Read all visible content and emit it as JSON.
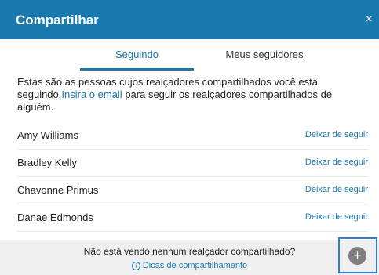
{
  "header": {
    "title": "Compartilhar",
    "close_glyph": "×"
  },
  "tabs": [
    {
      "label": "Seguindo",
      "active": true
    },
    {
      "label": "Meus seguidores",
      "active": false
    }
  ],
  "intro": {
    "text_before": "Estas são as pessoas cujos realçadores compartilhados você está seguindo.",
    "link": "Insira o email",
    "text_after": " para seguir os realçadores compartilhados de alguém."
  },
  "people": [
    {
      "name": "Amy Williams",
      "action": "Deixar de seguir"
    },
    {
      "name": "Bradley Kelly",
      "action": "Deixar de seguir"
    },
    {
      "name": "Chavonne Primus",
      "action": "Deixar de seguir"
    },
    {
      "name": "Danae Edmonds",
      "action": "Deixar de seguir"
    }
  ],
  "footer": {
    "question": "Não está vendo nenhum realçador compartilhado?",
    "tips_icon": "ⓘ",
    "tips_link": "Dicas de compartilhamento"
  },
  "fab": {
    "glyph": "+",
    "icon": "add-icon"
  },
  "colors": {
    "accent": "#1a7ab0",
    "footer_bg": "#efefef",
    "fab": "#7e7e7e"
  }
}
